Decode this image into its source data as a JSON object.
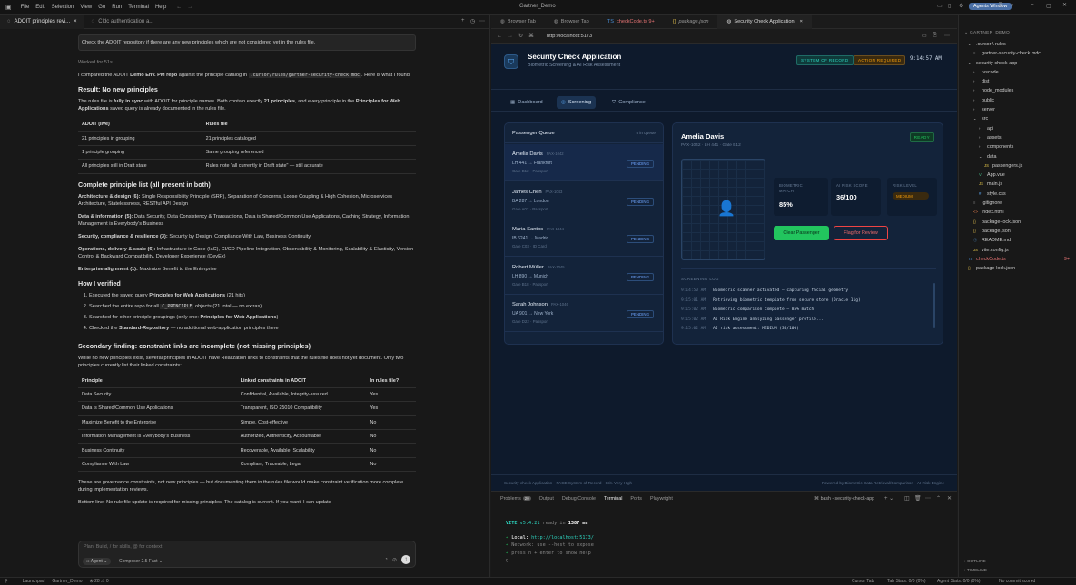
{
  "window": {
    "title": "Gartner_Demo",
    "agents_window": "Agents Window"
  },
  "menu": [
    "File",
    "Edit",
    "Selection",
    "View",
    "Go",
    "Run",
    "Terminal",
    "Help"
  ],
  "chat": {
    "tabs": [
      "ADOIT principles revi...",
      "Cldc authentication a..."
    ],
    "user_message": "Check the ADOIT repository if there are any new principles which are not considered yet in the rules file.",
    "worked_for": "Worked for 51s",
    "intro_a": "I compared the ADOIT ",
    "intro_b": "Demo Env. PM repo",
    "intro_c": " against the principle catalog in ",
    "intro_code": ".cursor/rules/gartner-security-check.mdc",
    "intro_d": ". Here is what I found.",
    "result_heading": "Result: No new principles",
    "result_p1a": "The rules file is ",
    "result_p1b": "fully in sync",
    "result_p1c": " with ADOIT for principle names. Both contain exactly ",
    "result_p1d": "21 principles",
    "result_p1e": ", and every principle in the ",
    "result_p1f": "Principles for Web Applications",
    "result_p1g": " saved query is already documented in the rules file.",
    "table1": {
      "headers": [
        "ADOIT (live)",
        "Rules file"
      ],
      "rows": [
        [
          "21 principles in grouping",
          "21 principles cataloged"
        ],
        [
          "1 principle grouping",
          "Same grouping referenced"
        ],
        [
          "All principles still in Draft state",
          "Rules note \"all currently in Draft state\" — still accurate"
        ]
      ]
    },
    "list_heading": "Complete principle list (all present in both)",
    "groups": [
      {
        "title": "Architecture & design (6):",
        "text": " Single Responsibility Principle (SRP), Separation of Concerns, Loose Coupling & High Cohesion, Microservices Architecture, Statelessness, RESTful API Design"
      },
      {
        "title": "Data & information (5):",
        "text": " Data Security, Data Consistency & Transactions, Data is Shared/Common Use Applications, Caching Strategy, Information Management is Everybody's Business"
      },
      {
        "title": "Security, compliance & resilience (3):",
        "text": " Security by Design, Compliance With Law, Business Continuity"
      },
      {
        "title": "Operations, delivery & scale (6):",
        "text": " Infrastructure in Code (IaC), CI/CD Pipeline Integration, Observability & Monitoring, Scalability & Elasticity, Version Control & Backward Compatibility, Developer Experience (DevEx)"
      },
      {
        "title": "Enterprise alignment (1):",
        "text": " Maximize Benefit to the Enterprise"
      }
    ],
    "verified_heading": "How I verified",
    "verified": [
      {
        "a": "Executed the saved query ",
        "b": "Principles for Web Applications",
        "c": " (21 hits)"
      },
      {
        "a": "Searched the entire repo for all ",
        "code": "C_PRINCIPLE",
        "c": " objects (21 total — no extras)"
      },
      {
        "a": "Searched for other principle groupings (only one: ",
        "b": "Principles for Web Applications",
        "c": ")"
      },
      {
        "a": "Checked the ",
        "b": "Standard-Repository",
        "c": " — no additional web-application principles there"
      }
    ],
    "secondary_heading": "Secondary finding: constraint links are incomplete (not missing principles)",
    "secondary_p": "While no new principles exist, several principles in ADOIT have Realization links to constraints that the rules file does not yet document. Only two principles currently list their linked constraints:",
    "table2": {
      "headers": [
        "Principle",
        "Linked constraints in ADOIT",
        "In rules file?"
      ],
      "rows": [
        [
          "Data Security",
          "Confidential, Available, Integrity-assured",
          "Yes"
        ],
        [
          "Data is Shared/Common Use Applications",
          "Transparent, ISO 25010 Compatibility",
          "Yes"
        ],
        [
          "Maximize Benefit to the Enterprise",
          "Simple, Cost-effective",
          "No"
        ],
        [
          "Information Management is Everybody's Business",
          "Authorized, Authenticity, Accountable",
          "No"
        ],
        [
          "Business Continuity",
          "Recoverable, Available, Scalability",
          "No"
        ],
        [
          "Compliance With Law",
          "Compliant, Traceable, Legal",
          "No"
        ]
      ]
    },
    "closing_p": "These are governance constraints, not new principles — but documenting them in the rules file would make constraint verification more complete during implementation reviews.",
    "bottom_line": "Bottom line: No rule file update is required for missing principles. The catalog is current. If you want, I can update",
    "composer_placeholder": "Plan, Build, / for skills, @ for context",
    "agent_label": "Agent",
    "model_label": "Composer 2.5 Fast"
  },
  "browser": {
    "tabs": [
      "Browser Tab",
      "Browser Tab",
      "checkCode.ts 9+",
      "package.json",
      "Security Check Application"
    ],
    "url": "http://localhost:5173"
  },
  "app": {
    "title": "Security Check Application",
    "subtitle": "Biometric Screening & AI Risk Assessment",
    "badge_sor": "SYSTEM OF RECORD",
    "badge_action": "ACTION REQUIRED",
    "time": "9:14:57 AM",
    "nav": [
      "Dashboard",
      "Screening",
      "Compliance"
    ],
    "queue_title": "Passenger Queue",
    "queue_count": "5 in queue",
    "passengers": [
      {
        "name": "Amelia Davis",
        "id": "PAX-1042",
        "flight": "LH 441  →  Frankfurt",
        "meta": "Gate B12  ·  Passport",
        "status": "PENDING"
      },
      {
        "name": "James Chen",
        "id": "PAX-1043",
        "flight": "BA 287  →  London",
        "meta": "Gate A07  ·  Passport",
        "status": "PENDING"
      },
      {
        "name": "Maria Santos",
        "id": "PAX-1044",
        "flight": "IB 6241  →  Madrid",
        "meta": "Gate C03  ·  ID Card",
        "status": "PENDING"
      },
      {
        "name": "Robert Müller",
        "id": "PAX-1045",
        "flight": "LH 890  →  Munich",
        "meta": "Gate B18  ·  Passport",
        "status": "PENDING"
      },
      {
        "name": "Sarah Johnson",
        "id": "PAX-1046",
        "flight": "UA 901  →  New York",
        "meta": "Gate D22  ·  Passport",
        "status": "PENDING"
      }
    ],
    "detail": {
      "name": "Amelia Davis",
      "sub": "PAX-1042  ·  LH 441  ·  Gate B12",
      "status": "READY",
      "biometric_label": "BIOMETRIC MATCH",
      "biometric_value": "85%",
      "ai_label": "AI RISK SCORE",
      "ai_value": "36/100",
      "risk_label": "RISK LEVEL",
      "risk_value": "MEDIUM",
      "clear_button": "Clear Passenger",
      "flag_button": "Flag for Review",
      "log_title": "SCREENING LOG",
      "log": [
        {
          "t": "9:14:50 AM",
          "m": "Biometric scanner activated — capturing facial geometry"
        },
        {
          "t": "9:15:01 AM",
          "m": "Retrieving biometric template from secure store (Oracle 11g)"
        },
        {
          "t": "9:15:02 AM",
          "m": "Biometric comparison complete — 85% match"
        },
        {
          "t": "9:15:02 AM",
          "m": "AI Risk Engine analyzing passenger profile..."
        },
        {
          "t": "9:15:02 AM",
          "m": "AI risk assessment: MEDIUM (36/100)"
        }
      ]
    },
    "footer_left": "Security check Application · PACE System of Record · Crit. Very High",
    "footer_right": "Powered by Biometric Data Retrieval/Comparison · AI Risk Engine"
  },
  "terminal": {
    "tabs": [
      "Problems",
      "Output",
      "Debug Console",
      "Terminal",
      "Ports",
      "Playwright"
    ],
    "problems_count": "20",
    "shell_label": "bash - security-check-app",
    "vite_name": "VITE",
    "vite_version": "v5.4.21",
    "ready_a": "ready in ",
    "ready_b": "1387 ms",
    "local_label": "Local:",
    "local_url": "http://localhost:5173/",
    "network_line": "Network: use --host to expose",
    "help_line": "press h + enter to show help"
  },
  "explorer": {
    "root": "GARTNER_DEMO",
    "items": [
      {
        "label": ".cursor \\ rules",
        "indent": 1,
        "type": "folder",
        "open": true
      },
      {
        "label": "gartner-security-check.mdc",
        "indent": 2,
        "type": "file"
      },
      {
        "label": "security-check-app",
        "indent": 1,
        "type": "folder",
        "open": true
      },
      {
        "label": ".vscode",
        "indent": 2,
        "type": "folder"
      },
      {
        "label": "dist",
        "indent": 2,
        "type": "folder"
      },
      {
        "label": "node_modules",
        "indent": 2,
        "type": "folder"
      },
      {
        "label": "public",
        "indent": 2,
        "type": "folder"
      },
      {
        "label": "server",
        "indent": 2,
        "type": "folder"
      },
      {
        "label": "src",
        "indent": 2,
        "type": "folder",
        "open": true
      },
      {
        "label": "api",
        "indent": 3,
        "type": "folder"
      },
      {
        "label": "assets",
        "indent": 3,
        "type": "folder"
      },
      {
        "label": "components",
        "indent": 3,
        "type": "folder"
      },
      {
        "label": "data",
        "indent": 3,
        "type": "folder",
        "open": true
      },
      {
        "label": "passengers.js",
        "indent": 4,
        "type": "js"
      },
      {
        "label": "App.vue",
        "indent": 3,
        "type": "vue"
      },
      {
        "label": "main.js",
        "indent": 3,
        "type": "js"
      },
      {
        "label": "style.css",
        "indent": 3,
        "type": "css"
      },
      {
        "label": ".gitignore",
        "indent": 2,
        "type": "file"
      },
      {
        "label": "index.html",
        "indent": 2,
        "type": "html"
      },
      {
        "label": "package-lock.json",
        "indent": 2,
        "type": "json"
      },
      {
        "label": "package.json",
        "indent": 2,
        "type": "json"
      },
      {
        "label": "README.md",
        "indent": 2,
        "type": "md"
      },
      {
        "label": "vite.config.js",
        "indent": 2,
        "type": "js"
      },
      {
        "label": "checkCode.ts",
        "indent": 1,
        "type": "ts",
        "badge": "9+"
      },
      {
        "label": "package-lock.json",
        "indent": 1,
        "type": "json"
      }
    ],
    "outline": "OUTLINE",
    "timeline": "TIMELINE"
  },
  "status": {
    "launchpad": "Launchpad",
    "workspace": "Gartner_Demo",
    "counts": "⊗ 28 ⚠ 0",
    "cursor_tab": "Cursor Tab",
    "tab_stats": "Tab Stats: 0/0 (0%)",
    "agent_stats": "Agent Stats: 0/0 (0%)",
    "commit": "No commit scored"
  },
  "colors": {
    "accent": "#3b82f6",
    "success": "#22c55e",
    "warning": "#f59e0b",
    "danger": "#ef4444",
    "teal": "#2dd4bf"
  }
}
